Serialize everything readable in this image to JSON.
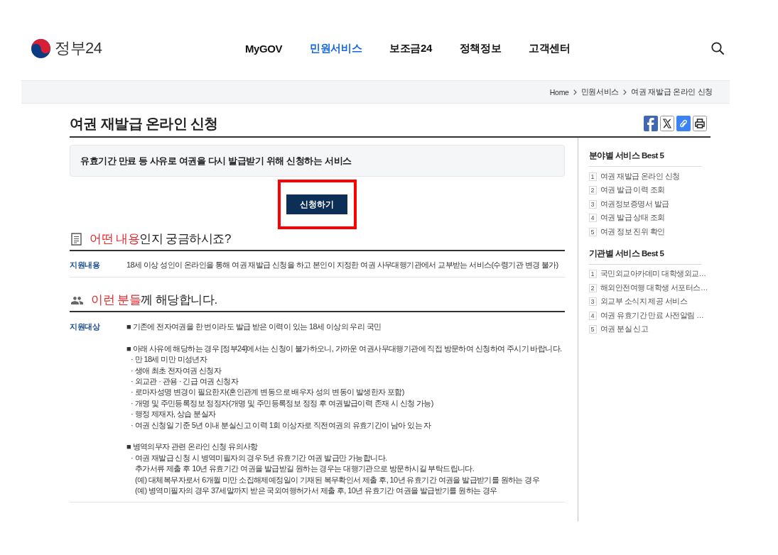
{
  "header": {
    "logo": "정부24",
    "nav": [
      {
        "label": "MyGOV",
        "selected": false
      },
      {
        "label": "민원서비스",
        "selected": true
      },
      {
        "label": "보조금24",
        "selected": false
      },
      {
        "label": "정책정보",
        "selected": false
      },
      {
        "label": "고객센터",
        "selected": false
      }
    ]
  },
  "breadcrumb": [
    "Home",
    "민원서비스",
    "여권 재발급 온라인 신청"
  ],
  "page": {
    "title": "여권 재발급 온라인 신청",
    "summary": "유효기간 만료 등 사유로 여권을 다시 발급받기 위해 신청하는 서비스",
    "apply_button": {
      "label": "신청하기",
      "highlighted": true
    }
  },
  "sections": [
    {
      "kind": "content",
      "accent": "어떤 내용",
      "rest": "인지 궁금하시죠?",
      "rows": [
        {
          "label": "지원내용",
          "groups": [
            {
              "lines": [
                {
                  "kind": "plain",
                  "text": "18세 이상 성인이 온라인을 통해 여권 재발급 신청을 하고 본인이 지정한 여권 사무대행기관에서 교부받는 서비스(수령기관 변경 불가)"
                }
              ]
            }
          ]
        }
      ]
    },
    {
      "kind": "audience",
      "accent": "이런 분들",
      "rest": "께 해당합니다.",
      "rows": [
        {
          "label": "지원대상",
          "groups": [
            {
              "lines": [
                {
                  "kind": "heading",
                  "text": "■ 기존에 전자여권을 한 번이라도 발급 받은 이력이 있는 18세 이상의 우리 국민"
                }
              ]
            },
            {
              "lines": [
                {
                  "kind": "heading",
                  "text": "■ 아래 사유에 해당하는 경우 [정부24]에서는 신청이 불가하오니, 가까운 여권사무대행기관에 직접 방문하여 신청하여 주시기 바랍니다."
                },
                {
                  "kind": "bullet",
                  "text": "· 만 18세 미만 미성년자"
                },
                {
                  "kind": "bullet",
                  "text": "· 생애 최초 전자여권 신청자"
                },
                {
                  "kind": "bullet",
                  "text": "· 외교관 · 관용 · 긴급 여권 신청자"
                },
                {
                  "kind": "bullet",
                  "text": "· 로마자성명 변경이 필요한자(혼인관계 변동으로 배우자 성의 변동이 발생한자 포함)"
                },
                {
                  "kind": "bullet",
                  "text": "· 개명 및 주민등록정보 정정자(개명 및 주민등록정보 정정 후 여권발급이력 존재 시 신청 가능)"
                },
                {
                  "kind": "bullet",
                  "text": "· 행정 제재자, 상습 분실자"
                },
                {
                  "kind": "bullet",
                  "text": "· 여권 신청일 기준 5년 이내 분실신고 이력 1회 이상자로 직전여권의 유효기간이 남아 있는 자"
                }
              ]
            },
            {
              "lines": [
                {
                  "kind": "heading",
                  "text": "■ 병역의무자 관련 온라인 신청 유의사항"
                },
                {
                  "kind": "bullet",
                  "text": "· 여권 재발급 신청 시 병역미필자의 경우 5년 유효기간 여권 발급만 가능합니다."
                },
                {
                  "kind": "note",
                  "text": "추가서류 제출 후 10년 유효기간 여권을 발급받길 원하는 경우는 대행기관으로 방문하시길 부탁드립니다."
                },
                {
                  "kind": "note",
                  "text": "(예) 대체복무자로서 6개월 미만 소집해제예정일이 기재된 복무확인서 제출 후, 10년 유효기간 여권을 발급받기를 원하는 경우"
                },
                {
                  "kind": "note",
                  "text": "(예) 병역미필자의 경우 37세말까지 받은 국외여행허가서 제출 후, 10년 유효기간 여권을 발급받기를 원하는 경우"
                }
              ]
            }
          ]
        }
      ]
    }
  ],
  "sidebar": {
    "lists": [
      {
        "title": "분야별 서비스 Best 5",
        "items": [
          {
            "rank": "1",
            "label": "여권 재발급 온라인 신청"
          },
          {
            "rank": "2",
            "label": "여권 발급 이력 조회"
          },
          {
            "rank": "3",
            "label": "여권정보증명서 발급"
          },
          {
            "rank": "4",
            "label": "여권 발급 상태 조회"
          },
          {
            "rank": "5",
            "label": "여권 정보 진위 확인"
          }
        ]
      },
      {
        "title": "기관별 서비스 Best 5",
        "items": [
          {
            "rank": "1",
            "label": "국민외교아카데미 대학생외교…"
          },
          {
            "rank": "2",
            "label": "해외안전여행 대학생 서포터스…"
          },
          {
            "rank": "3",
            "label": "외교부 소식지 제공 서비스"
          },
          {
            "rank": "4",
            "label": "여권 유효기간 만료 사전알림 …"
          },
          {
            "rank": "5",
            "label": "여권 분실 신고"
          }
        ]
      }
    ]
  }
}
